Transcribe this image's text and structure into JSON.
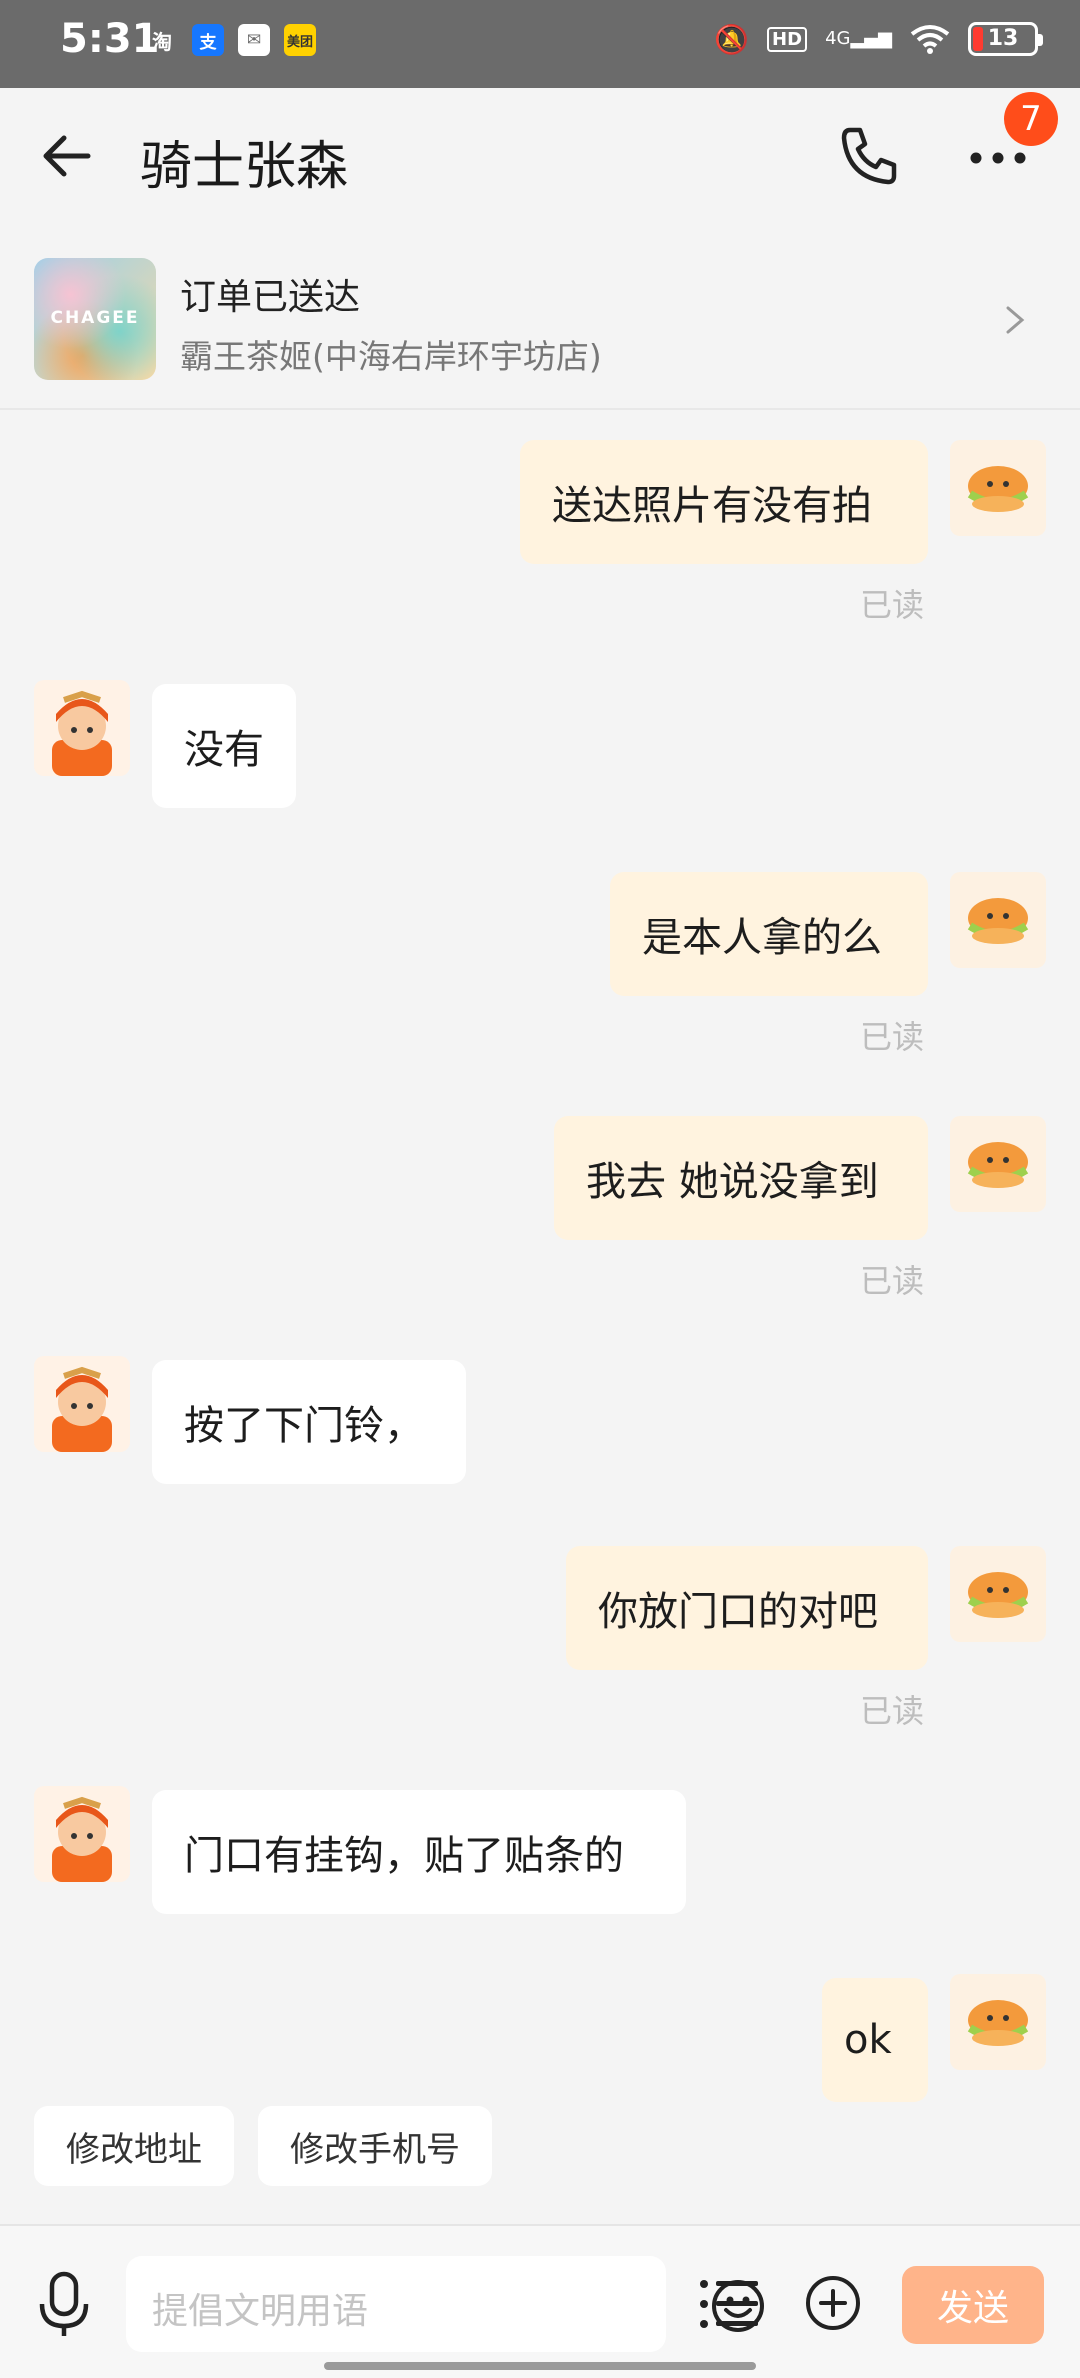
{
  "status_bar": {
    "time": "5:31",
    "apps": [
      "淘",
      "支",
      "✉",
      "美团"
    ],
    "network": "4G",
    "hd": "HD",
    "battery": "13"
  },
  "header": {
    "title": "骑士张森",
    "badge_count": "7"
  },
  "order": {
    "thumb_text": "CHAGEE",
    "status": "订单已送达",
    "store": "霸王茶姬(中海右岸环宇坊店)"
  },
  "messages": [
    {
      "from": "me",
      "text": "送达照片有没有拍",
      "read": "已读"
    },
    {
      "from": "rider",
      "text": "没有"
    },
    {
      "from": "me",
      "text": "是本人拿的么",
      "read": "已读"
    },
    {
      "from": "me",
      "text": "我去 她说没拿到",
      "read": "已读"
    },
    {
      "from": "rider",
      "text": "按了下门铃，"
    },
    {
      "from": "me",
      "text": "你放门口的对吧",
      "read": "已读"
    },
    {
      "from": "rider",
      "text": "门口有挂钩，贴了贴条的"
    },
    {
      "from": "me",
      "text": "ok"
    }
  ],
  "quick_actions": [
    "修改地址",
    "修改手机号"
  ],
  "input": {
    "placeholder": "提倡文明用语",
    "send_label": "发送"
  },
  "colors": {
    "my_bubble": "#fff3df",
    "rider_bubble": "#ffffff",
    "badge": "#ff4d1a",
    "send_button": "#ffb48a"
  }
}
